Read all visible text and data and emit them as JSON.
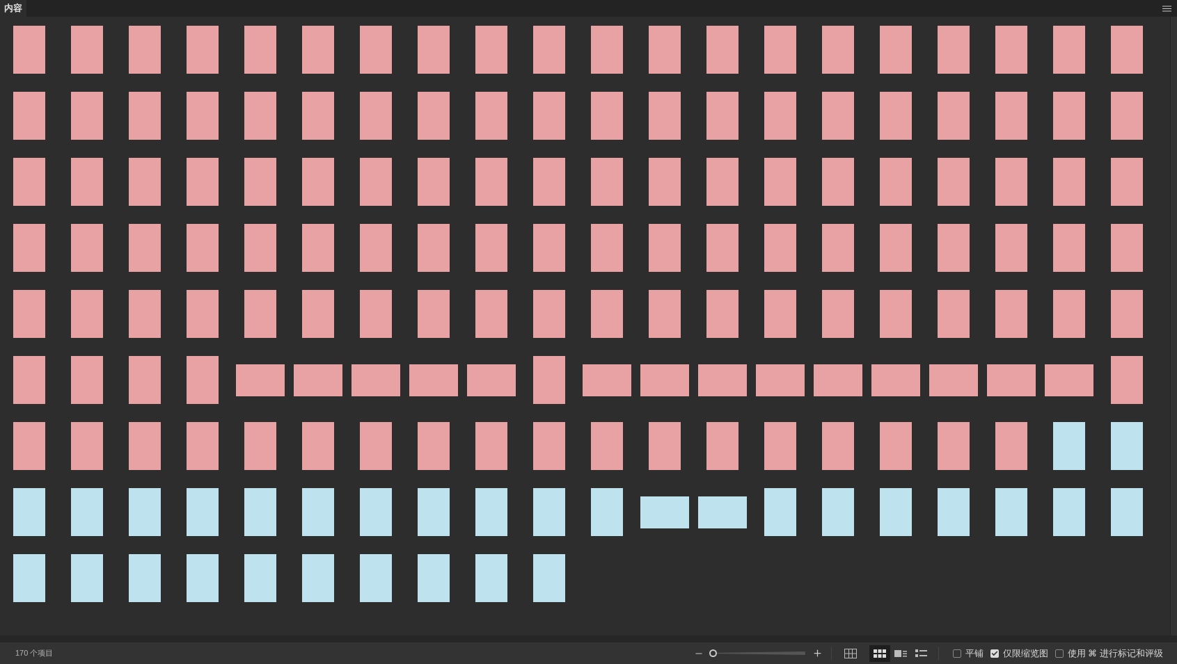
{
  "panel_tab": {
    "label": "内容"
  },
  "thumbnails": [
    {
      "kind": "portrait",
      "color": "#e9a2a4"
    },
    {
      "kind": "portrait",
      "color": "#e9a2a4"
    },
    {
      "kind": "portrait",
      "color": "#e9a2a4"
    },
    {
      "kind": "portrait",
      "color": "#e9a2a4"
    },
    {
      "kind": "portrait",
      "color": "#e9a2a4"
    },
    {
      "kind": "portrait",
      "color": "#e9a2a4"
    },
    {
      "kind": "portrait",
      "color": "#e9a2a4"
    },
    {
      "kind": "portrait",
      "color": "#e9a2a4"
    },
    {
      "kind": "portrait",
      "color": "#e9a2a4"
    },
    {
      "kind": "portrait",
      "color": "#e9a2a4"
    },
    {
      "kind": "portrait",
      "color": "#e9a2a4"
    },
    {
      "kind": "portrait",
      "color": "#e9a2a4"
    },
    {
      "kind": "portrait",
      "color": "#e9a2a4"
    },
    {
      "kind": "portrait",
      "color": "#e9a2a4"
    },
    {
      "kind": "portrait",
      "color": "#e9a2a4"
    },
    {
      "kind": "portrait",
      "color": "#e9a2a4"
    },
    {
      "kind": "portrait",
      "color": "#e9a2a4"
    },
    {
      "kind": "portrait",
      "color": "#e9a2a4"
    },
    {
      "kind": "portrait",
      "color": "#e9a2a4"
    },
    {
      "kind": "portrait",
      "color": "#e9a2a4"
    },
    {
      "kind": "portrait",
      "color": "#e9a2a4"
    },
    {
      "kind": "portrait",
      "color": "#e9a2a4"
    },
    {
      "kind": "portrait",
      "color": "#e9a2a4"
    },
    {
      "kind": "portrait",
      "color": "#e9a2a4"
    },
    {
      "kind": "portrait",
      "color": "#e9a2a4"
    },
    {
      "kind": "portrait",
      "color": "#e9a2a4"
    },
    {
      "kind": "portrait",
      "color": "#e9a2a4"
    },
    {
      "kind": "portrait",
      "color": "#e9a2a4"
    },
    {
      "kind": "portrait",
      "color": "#e9a2a4"
    },
    {
      "kind": "portrait",
      "color": "#e9a2a4"
    },
    {
      "kind": "portrait",
      "color": "#e9a2a4"
    },
    {
      "kind": "portrait",
      "color": "#e9a2a4"
    },
    {
      "kind": "portrait",
      "color": "#e9a2a4"
    },
    {
      "kind": "portrait",
      "color": "#e9a2a4"
    },
    {
      "kind": "portrait",
      "color": "#e9a2a4"
    },
    {
      "kind": "portrait",
      "color": "#e9a2a4"
    },
    {
      "kind": "portrait",
      "color": "#e9a2a4"
    },
    {
      "kind": "portrait",
      "color": "#e9a2a4"
    },
    {
      "kind": "portrait",
      "color": "#e9a2a4"
    },
    {
      "kind": "portrait",
      "color": "#e9a2a4"
    },
    {
      "kind": "portrait",
      "color": "#e9a2a4"
    },
    {
      "kind": "portrait",
      "color": "#e9a2a4"
    },
    {
      "kind": "portrait",
      "color": "#e9a2a4"
    },
    {
      "kind": "portrait",
      "color": "#e9a2a4"
    },
    {
      "kind": "portrait",
      "color": "#e9a2a4"
    },
    {
      "kind": "portrait",
      "color": "#e9a2a4"
    },
    {
      "kind": "portrait",
      "color": "#e9a2a4"
    },
    {
      "kind": "portrait",
      "color": "#e9a2a4"
    },
    {
      "kind": "portrait",
      "color": "#e9a2a4"
    },
    {
      "kind": "portrait",
      "color": "#e9a2a4"
    },
    {
      "kind": "portrait",
      "color": "#e9a2a4"
    },
    {
      "kind": "portrait",
      "color": "#e9a2a4"
    },
    {
      "kind": "portrait",
      "color": "#e9a2a4"
    },
    {
      "kind": "portrait",
      "color": "#e9a2a4"
    },
    {
      "kind": "portrait",
      "color": "#e9a2a4"
    },
    {
      "kind": "portrait",
      "color": "#e9a2a4"
    },
    {
      "kind": "portrait",
      "color": "#e9a2a4"
    },
    {
      "kind": "portrait",
      "color": "#e9a2a4"
    },
    {
      "kind": "portrait",
      "color": "#e9a2a4"
    },
    {
      "kind": "portrait",
      "color": "#e9a2a4"
    },
    {
      "kind": "portrait",
      "color": "#e9a2a4"
    },
    {
      "kind": "portrait",
      "color": "#e9a2a4"
    },
    {
      "kind": "portrait",
      "color": "#e9a2a4"
    },
    {
      "kind": "portrait",
      "color": "#e9a2a4"
    },
    {
      "kind": "portrait",
      "color": "#e9a2a4"
    },
    {
      "kind": "portrait",
      "color": "#e9a2a4"
    },
    {
      "kind": "portrait",
      "color": "#e9a2a4"
    },
    {
      "kind": "portrait",
      "color": "#e9a2a4"
    },
    {
      "kind": "portrait",
      "color": "#e9a2a4"
    },
    {
      "kind": "portrait",
      "color": "#e9a2a4"
    },
    {
      "kind": "portrait",
      "color": "#e9a2a4"
    },
    {
      "kind": "portrait",
      "color": "#e9a2a4"
    },
    {
      "kind": "portrait",
      "color": "#e9a2a4"
    },
    {
      "kind": "portrait",
      "color": "#e9a2a4"
    },
    {
      "kind": "portrait",
      "color": "#e9a2a4"
    },
    {
      "kind": "portrait",
      "color": "#e9a2a4"
    },
    {
      "kind": "portrait",
      "color": "#e9a2a4"
    },
    {
      "kind": "portrait",
      "color": "#e9a2a4"
    },
    {
      "kind": "portrait",
      "color": "#e9a2a4"
    },
    {
      "kind": "portrait",
      "color": "#e9a2a4"
    },
    {
      "kind": "portrait",
      "color": "#e9a2a4"
    },
    {
      "kind": "portrait",
      "color": "#e9a2a4"
    },
    {
      "kind": "portrait",
      "color": "#e9a2a4"
    },
    {
      "kind": "portrait",
      "color": "#e9a2a4"
    },
    {
      "kind": "portrait",
      "color": "#e9a2a4"
    },
    {
      "kind": "portrait",
      "color": "#e9a2a4"
    },
    {
      "kind": "portrait",
      "color": "#e9a2a4"
    },
    {
      "kind": "portrait",
      "color": "#e9a2a4"
    },
    {
      "kind": "portrait",
      "color": "#e9a2a4"
    },
    {
      "kind": "portrait",
      "color": "#e9a2a4"
    },
    {
      "kind": "portrait",
      "color": "#e9a2a4"
    },
    {
      "kind": "portrait",
      "color": "#e9a2a4"
    },
    {
      "kind": "portrait",
      "color": "#e9a2a4"
    },
    {
      "kind": "portrait",
      "color": "#e9a2a4"
    },
    {
      "kind": "portrait",
      "color": "#e9a2a4"
    },
    {
      "kind": "portrait",
      "color": "#e9a2a4"
    },
    {
      "kind": "portrait",
      "color": "#e9a2a4"
    },
    {
      "kind": "portrait",
      "color": "#e9a2a4"
    },
    {
      "kind": "portrait",
      "color": "#e9a2a4"
    },
    {
      "kind": "portrait",
      "color": "#e9a2a4"
    },
    {
      "kind": "portrait",
      "color": "#e9a2a4"
    },
    {
      "kind": "portrait",
      "color": "#e9a2a4"
    },
    {
      "kind": "portrait",
      "color": "#e9a2a4"
    },
    {
      "kind": "portrait",
      "color": "#e9a2a4"
    },
    {
      "kind": "landscape",
      "color": "#e9a2a4"
    },
    {
      "kind": "landscape",
      "color": "#e9a2a4"
    },
    {
      "kind": "landscape",
      "color": "#e9a2a4"
    },
    {
      "kind": "landscape",
      "color": "#e9a2a4"
    },
    {
      "kind": "landscape",
      "color": "#e9a2a4"
    },
    {
      "kind": "portrait",
      "color": "#e9a2a4"
    },
    {
      "kind": "landscape",
      "color": "#e9a2a4"
    },
    {
      "kind": "landscape",
      "color": "#e9a2a4"
    },
    {
      "kind": "landscape",
      "color": "#e9a2a4"
    },
    {
      "kind": "landscape",
      "color": "#e9a2a4"
    },
    {
      "kind": "landscape",
      "color": "#e9a2a4"
    },
    {
      "kind": "landscape",
      "color": "#e9a2a4"
    },
    {
      "kind": "landscape",
      "color": "#e9a2a4"
    },
    {
      "kind": "landscape",
      "color": "#e9a2a4"
    },
    {
      "kind": "landscape",
      "color": "#e9a2a4"
    },
    {
      "kind": "portrait",
      "color": "#e9a2a4"
    },
    {
      "kind": "portrait",
      "color": "#e9a2a4"
    },
    {
      "kind": "portrait",
      "color": "#e9a2a4"
    },
    {
      "kind": "portrait",
      "color": "#e9a2a4"
    },
    {
      "kind": "portrait",
      "color": "#e9a2a4"
    },
    {
      "kind": "portrait",
      "color": "#e9a2a4"
    },
    {
      "kind": "portrait",
      "color": "#e9a2a4"
    },
    {
      "kind": "portrait",
      "color": "#e9a2a4"
    },
    {
      "kind": "portrait",
      "color": "#e9a2a4"
    },
    {
      "kind": "portrait",
      "color": "#e9a2a4"
    },
    {
      "kind": "portrait",
      "color": "#e9a2a4"
    },
    {
      "kind": "portrait",
      "color": "#e9a2a4"
    },
    {
      "kind": "portrait",
      "color": "#e9a2a4"
    },
    {
      "kind": "portrait",
      "color": "#e9a2a4"
    },
    {
      "kind": "portrait",
      "color": "#e9a2a4"
    },
    {
      "kind": "portrait",
      "color": "#e9a2a4"
    },
    {
      "kind": "portrait",
      "color": "#e9a2a4"
    },
    {
      "kind": "portrait",
      "color": "#e9a2a4"
    },
    {
      "kind": "portrait",
      "color": "#e9a2a4"
    },
    {
      "kind": "portrait",
      "color": "#bfe3ee"
    },
    {
      "kind": "portrait",
      "color": "#bfe3ee"
    },
    {
      "kind": "portrait",
      "color": "#bfe3ee"
    },
    {
      "kind": "portrait",
      "color": "#bfe3ee"
    },
    {
      "kind": "portrait",
      "color": "#bfe3ee"
    },
    {
      "kind": "portrait",
      "color": "#bfe3ee"
    },
    {
      "kind": "portrait",
      "color": "#bfe3ee"
    },
    {
      "kind": "portrait",
      "color": "#bfe3ee"
    },
    {
      "kind": "portrait",
      "color": "#bfe3ee"
    },
    {
      "kind": "portrait",
      "color": "#bfe3ee"
    },
    {
      "kind": "portrait",
      "color": "#bfe3ee"
    },
    {
      "kind": "portrait",
      "color": "#bfe3ee"
    },
    {
      "kind": "portrait",
      "color": "#bfe3ee"
    },
    {
      "kind": "landscape",
      "color": "#bfe3ee"
    },
    {
      "kind": "landscape",
      "color": "#bfe3ee"
    },
    {
      "kind": "portrait",
      "color": "#bfe3ee"
    },
    {
      "kind": "portrait",
      "color": "#bfe3ee"
    },
    {
      "kind": "portrait",
      "color": "#bfe3ee"
    },
    {
      "kind": "portrait",
      "color": "#bfe3ee"
    },
    {
      "kind": "portrait",
      "color": "#bfe3ee"
    },
    {
      "kind": "portrait",
      "color": "#bfe3ee"
    },
    {
      "kind": "portrait",
      "color": "#bfe3ee"
    },
    {
      "kind": "portrait",
      "color": "#bfe3ee"
    },
    {
      "kind": "portrait",
      "color": "#bfe3ee"
    },
    {
      "kind": "portrait",
      "color": "#bfe3ee"
    },
    {
      "kind": "portrait",
      "color": "#bfe3ee"
    },
    {
      "kind": "portrait",
      "color": "#bfe3ee"
    },
    {
      "kind": "portrait",
      "color": "#bfe3ee"
    },
    {
      "kind": "portrait",
      "color": "#bfe3ee"
    },
    {
      "kind": "portrait",
      "color": "#bfe3ee"
    },
    {
      "kind": "portrait",
      "color": "#bfe3ee"
    },
    {
      "kind": "portrait",
      "color": "#bfe3ee"
    }
  ],
  "status_bar": {
    "item_count": "170 个项目",
    "zoom_slider": {
      "level": 0.0
    },
    "view_buttons": [
      {
        "kind": "grid",
        "selected": false
      },
      {
        "kind": "thumbnails",
        "selected": true
      },
      {
        "kind": "details",
        "selected": false
      },
      {
        "kind": "list",
        "selected": false
      }
    ],
    "options": [
      {
        "label": "平铺",
        "checked": false
      },
      {
        "label": "仅限缩览图",
        "checked": true
      },
      {
        "label": "使用 ⌘ 进行标记和评级",
        "checked": false
      }
    ]
  }
}
